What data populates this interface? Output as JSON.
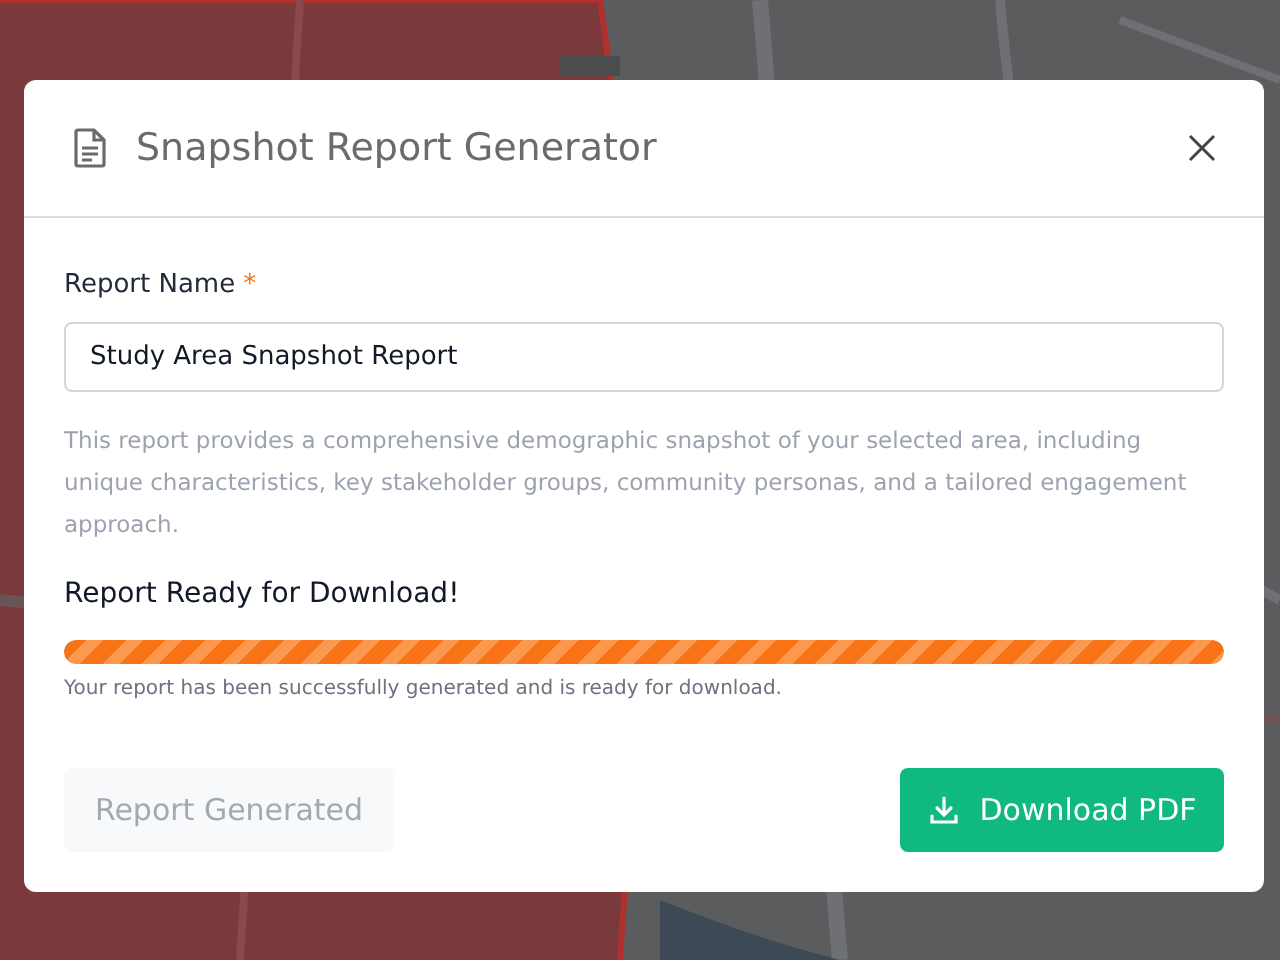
{
  "dialog": {
    "title": "Snapshot Report Generator",
    "field": {
      "label": "Report Name",
      "required_mark": "*",
      "value": "Study Area Snapshot Report"
    },
    "description": "This report provides a comprehensive demographic snapshot of your selected area, including unique characteristics, key stakeholder groups, community personas, and a tailored engagement approach.",
    "status_title": "Report Ready for Download!",
    "progress": {
      "level": 1
    },
    "status_message": "Your report has been successfully generated and is ready for download.",
    "buttons": [
      {
        "label": "Report Generated",
        "kind": "secondary",
        "disabled": true
      },
      {
        "label": "Download PDF",
        "kind": "primary",
        "disabled": false
      }
    ]
  }
}
